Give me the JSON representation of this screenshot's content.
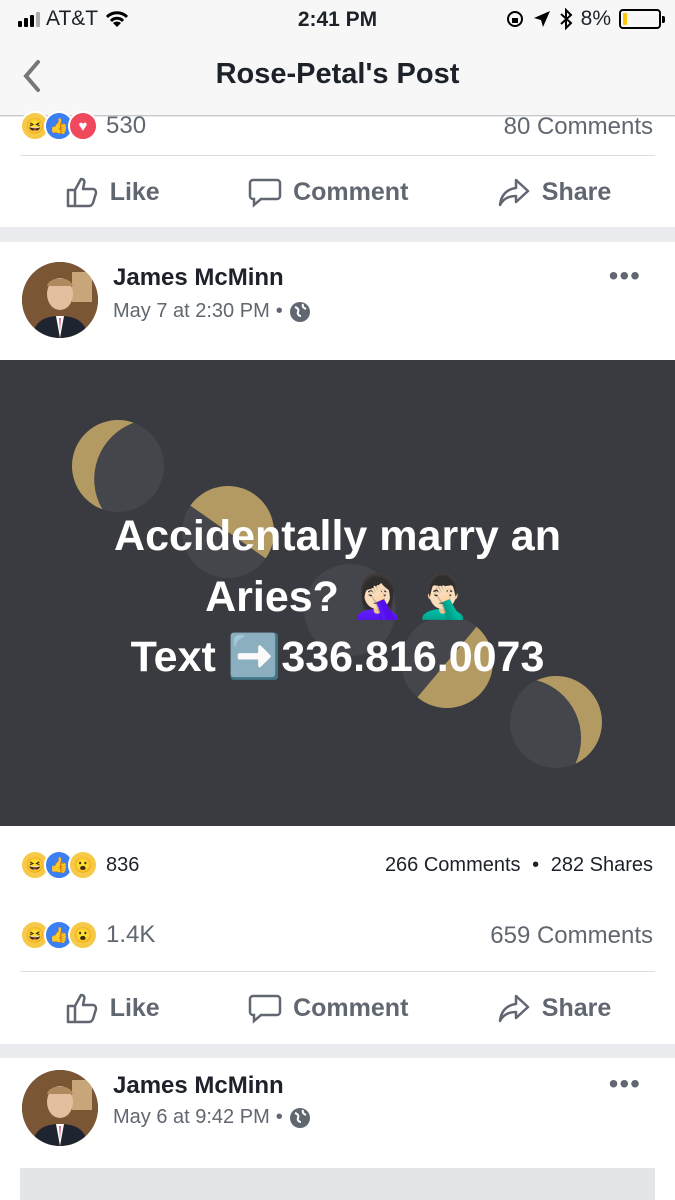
{
  "status": {
    "carrier": "AT&T",
    "time": "2:41 PM",
    "battery": "8%"
  },
  "nav": {
    "title": "Rose-Petal's Post"
  },
  "prev_post": {
    "reactions_count": "530",
    "comments": "80 Comments"
  },
  "actions": {
    "like": "Like",
    "comment": "Comment",
    "share": "Share"
  },
  "post1": {
    "author": "James McMinn",
    "date": "May 7 at 2:30 PM",
    "separator": "•",
    "image_text": {
      "line1": "Accidentally marry an",
      "line2": "Aries? 🤦🏻‍♀️ 🤦🏻‍♂️",
      "line3_prefix": "Text ",
      "line3_arrow": "➡️",
      "line3_number": "336.816.0073"
    },
    "image_stats": {
      "reactions_count": "836",
      "comments": "266 Comments",
      "sep": "•",
      "shares": "282 Shares"
    },
    "reactions_count": "1.4K",
    "comments": "659 Comments"
  },
  "post2": {
    "author": "James McMinn",
    "date": "May 6 at 9:42 PM",
    "separator": "•"
  },
  "icons": [
    "back-chevron-icon",
    "wifi-icon",
    "location-icon",
    "bluetooth-icon",
    "lock-rotation-icon",
    "like-icon",
    "comment-icon",
    "share-icon",
    "globe-icon",
    "more-icon"
  ],
  "colors": {
    "accent": "#3b7ff2",
    "image_bg": "#393b40",
    "moon": "#b39a62",
    "battery_low": "#ffc40c"
  }
}
